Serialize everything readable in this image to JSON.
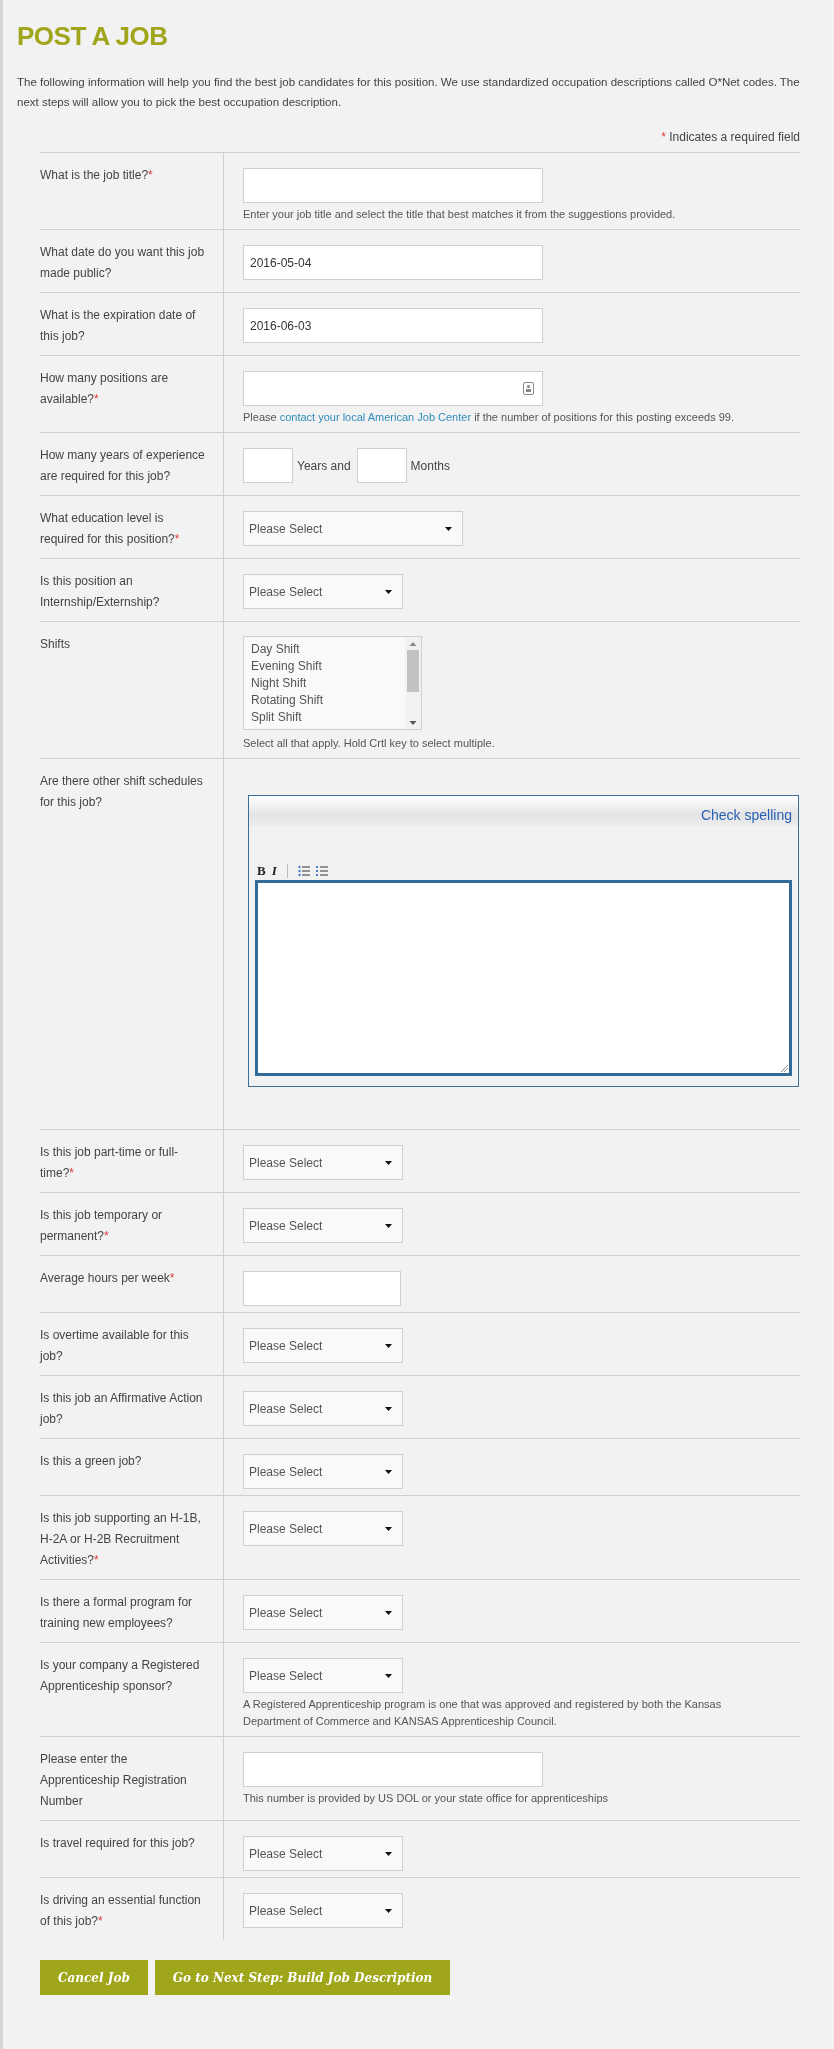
{
  "title": "POST A JOB",
  "intro": "The following information will help you find the best job candidates for this position. We use standardized occupation descriptions called O*Net codes. The next steps will allow you to pick the best occupation description.",
  "required_note": {
    "mark": "*",
    "text": "Indicates a required field"
  },
  "rows": [
    {
      "kind": "text",
      "label": "What is the job title?",
      "mark": "*",
      "value": "",
      "help": [
        {
          "kind": "text",
          "text": "Enter your job title and select the title that best matches it from the suggestions provided."
        }
      ]
    },
    {
      "kind": "text",
      "label": "What date do you want this job made public?",
      "value": "2016-05-04"
    },
    {
      "kind": "text",
      "label": "What is the expiration date of this job?",
      "value": "2016-06-03"
    },
    {
      "kind": "number",
      "label": "How many positions are available?",
      "mark": "*",
      "value": "",
      "help": [
        {
          "kind": "text",
          "text": "Please "
        },
        {
          "kind": "link",
          "text": "contact your local American Job Center"
        },
        {
          "kind": "text",
          "text": " if the number of positions for this posting exceeds 99."
        }
      ]
    },
    {
      "kind": "experience",
      "label": "How many years of experience are required for this job?",
      "units": [
        "Years and",
        "Months"
      ]
    },
    {
      "kind": "select",
      "label": "What education level is required for this position?",
      "mark": "*",
      "value": "Please Select",
      "wide": true
    },
    {
      "kind": "select",
      "label": "Is this position an Internship/Externship?",
      "value": "Please Select"
    },
    {
      "kind": "listbox",
      "label": "Shifts",
      "options": [
        "Day Shift",
        "Evening Shift",
        "Night Shift",
        "Rotating Shift",
        "Split Shift"
      ],
      "help": [
        {
          "kind": "text",
          "text": "Select all that apply. Hold Crtl key to select multiple."
        }
      ]
    },
    {
      "kind": "editor",
      "label": "Are there other shift schedules for this job?",
      "spell": "Check spelling",
      "tools": [
        "B",
        "I"
      ]
    },
    {
      "kind": "select",
      "label": "Is this job part-time or full-time?",
      "mark": "*",
      "value": "Please Select"
    },
    {
      "kind": "select",
      "label": "Is this job temporary or permanent?",
      "mark": "*",
      "value": "Please Select"
    },
    {
      "kind": "short",
      "label": "Average hours per week",
      "mark": "*",
      "value": ""
    },
    {
      "kind": "select",
      "label": "Is overtime available for this job?",
      "value": "Please Select"
    },
    {
      "kind": "select",
      "label": "Is this job an Affirmative Action job?",
      "value": "Please Select"
    },
    {
      "kind": "select",
      "label": "Is this a green job?",
      "value": "Please Select"
    },
    {
      "kind": "select",
      "label": "Is this job supporting an H-1B, H-2A or H-2B Recruitment Activities?",
      "mark": "*",
      "value": "Please Select"
    },
    {
      "kind": "select",
      "label": "Is there a formal program for training new employees?",
      "value": "Please Select"
    },
    {
      "kind": "select",
      "label": "Is your company a Registered Apprenticeship sponsor?",
      "value": "Please Select",
      "help": [
        {
          "kind": "text",
          "text": "A Registered Apprenticeship program is one that was approved and registered by both the Kansas Department of Commerce and KANSAS Apprenticeship Council."
        }
      ]
    },
    {
      "kind": "text",
      "label": "Please enter the Apprenticeship Registration Number",
      "value": "",
      "help": [
        {
          "kind": "text",
          "text": "This number is provided by US DOL or your state office for apprenticeships"
        }
      ]
    },
    {
      "kind": "select",
      "label": "Is travel required for this job?",
      "value": "Please Select"
    },
    {
      "kind": "select",
      "label": "Is driving an essential function of this job?",
      "mark": "*",
      "value": "Please Select"
    }
  ],
  "buttons": [
    "Cancel Job",
    "Go to Next Step: Build Job Description"
  ]
}
